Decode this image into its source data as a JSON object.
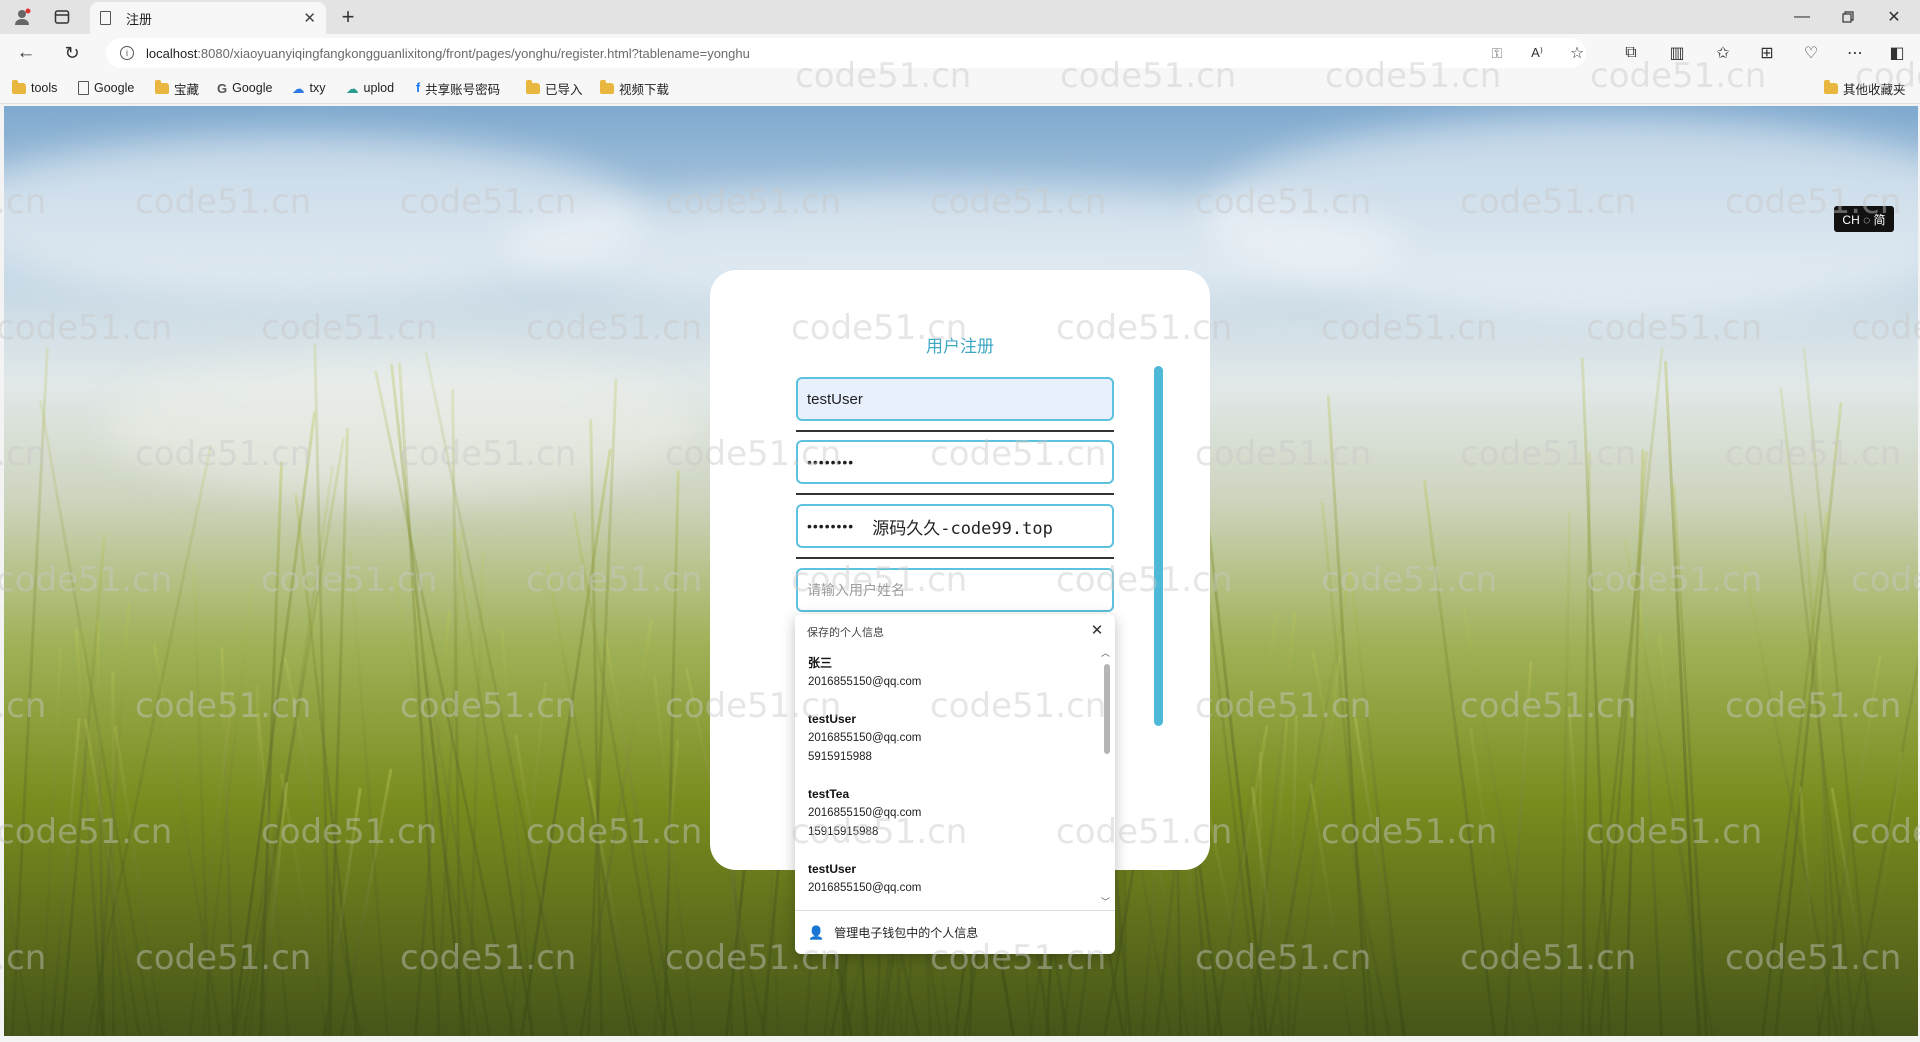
{
  "browser": {
    "tab_title": "注册",
    "url_host": "localhost",
    "url_path": ":8080/xiaoyuanyiqingfangkongguanlixitong/front/pages/yonghu/register.html?tablename=yonghu",
    "bookmarks": [
      "tools",
      "Google",
      "宝藏",
      "Google",
      "txy",
      "uplod",
      "共享账号密码",
      "已导入",
      "视频下载"
    ],
    "other_bookmarks": "其他收藏夹"
  },
  "watermark_text": "code51.cn",
  "ime_indicator": "CH ◌ 简",
  "register": {
    "title": "用户注册",
    "username_value": "testUser",
    "password_value": "••••••••",
    "confirm_password_value": "••••••••",
    "overlay_text": "源码久久-code99.top",
    "name_placeholder": "请输入用户姓名"
  },
  "autofill": {
    "header": "保存的个人信息",
    "entries": [
      {
        "name": "张三",
        "lines": [
          "2016855150@qq.com"
        ]
      },
      {
        "name": "testUser",
        "lines": [
          "2016855150@qq.com",
          "5915915988"
        ]
      },
      {
        "name": "testTea",
        "lines": [
          "2016855150@qq.com",
          "15915915988"
        ]
      },
      {
        "name": "testUser",
        "lines": [
          "2016855150@qq.com"
        ]
      }
    ],
    "footer": "管理电子钱包中的个人信息"
  }
}
